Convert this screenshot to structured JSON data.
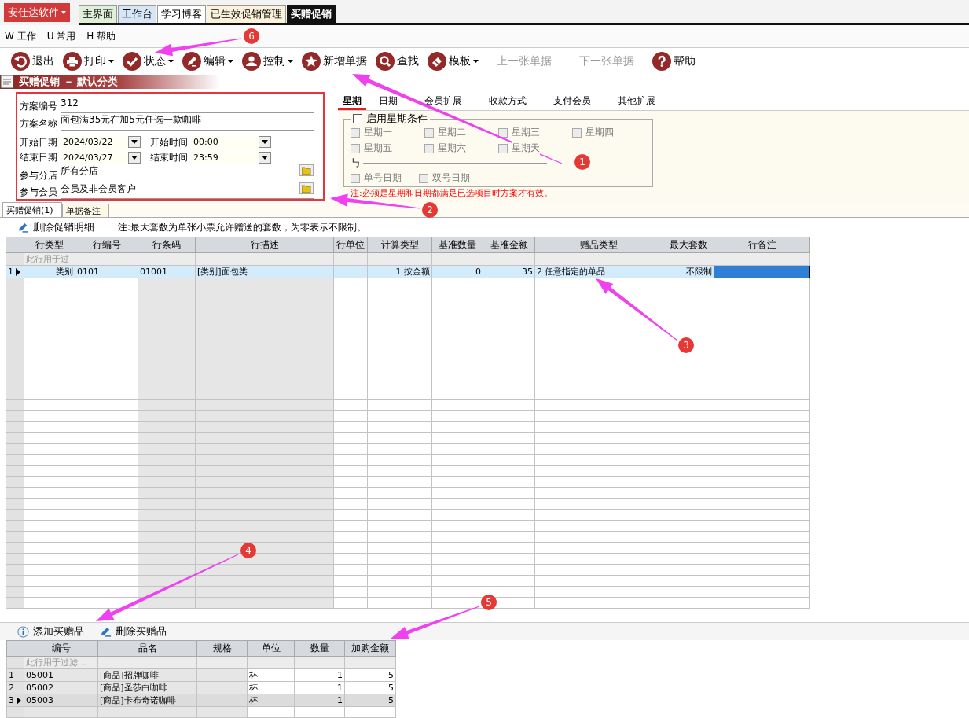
{
  "app_menu": {
    "label": "安仕达软件"
  },
  "doc_tabs": [
    {
      "label": "主界面",
      "color": "#dff0d8",
      "selected": false
    },
    {
      "label": "工作台",
      "color": "#d6e6f7",
      "selected": false
    },
    {
      "label": "学习博客",
      "color": "#ffffff",
      "selected": false
    },
    {
      "label": "已生效促销管理",
      "color": "#fbf2dc",
      "selected": false
    },
    {
      "label": "买赠促销",
      "color": "#111111",
      "selected": true
    }
  ],
  "menu": [
    "W 工作",
    "U 常用",
    "H 帮助"
  ],
  "toolbar": [
    {
      "label": "退出",
      "dropdown": false,
      "disabled": false
    },
    {
      "label": "打印",
      "dropdown": true,
      "disabled": false
    },
    {
      "label": "状态",
      "dropdown": true,
      "disabled": false
    },
    {
      "label": "编辑",
      "dropdown": true,
      "disabled": false
    },
    {
      "label": "控制",
      "dropdown": true,
      "disabled": false
    },
    {
      "label": "新增单据",
      "dropdown": false,
      "disabled": false
    },
    {
      "label": "查找",
      "dropdown": false,
      "disabled": false
    },
    {
      "label": "模板",
      "dropdown": true,
      "disabled": false
    },
    {
      "label": "上一张单据",
      "dropdown": false,
      "disabled": true
    },
    {
      "label": "下一张单据",
      "dropdown": false,
      "disabled": true
    },
    {
      "label": "帮助",
      "dropdown": false,
      "disabled": false
    }
  ],
  "document_title": "买赠促销 － 默认分类",
  "form": {
    "scheme_no": {
      "label": "方案编号",
      "value": "312"
    },
    "scheme_name": {
      "label": "方案名称",
      "value": "面包满35元在加5元任选一款咖啡"
    },
    "start_date": {
      "label": "开始日期",
      "value": "2024/03/22"
    },
    "start_time": {
      "label": "开始时间",
      "value": "00:00"
    },
    "end_date": {
      "label": "结束日期",
      "value": "2024/03/27"
    },
    "end_time": {
      "label": "结束时间",
      "value": "23:59"
    },
    "stores": {
      "label": "参与分店",
      "value": "所有分店"
    },
    "members": {
      "label": "参与会员",
      "value": "会员及非会员客户"
    }
  },
  "condition_tabs": [
    {
      "label": "星期",
      "selected": true
    },
    {
      "label": "日期",
      "selected": false
    },
    {
      "label": "会员扩展",
      "selected": false
    },
    {
      "label": "收款方式",
      "selected": false
    },
    {
      "label": "支付会员",
      "selected": false
    },
    {
      "label": "其他扩展",
      "selected": false
    }
  ],
  "weekday_panel": {
    "enable": {
      "label": "启用星期条件",
      "checked": false
    },
    "days": [
      {
        "label": "星期一",
        "checked": false,
        "disabled": true
      },
      {
        "label": "星期二",
        "checked": false,
        "disabled": true
      },
      {
        "label": "星期三",
        "checked": false,
        "disabled": true
      },
      {
        "label": "星期四",
        "checked": false,
        "disabled": true
      },
      {
        "label": "星期五",
        "checked": false,
        "disabled": true
      },
      {
        "label": "星期六",
        "checked": false,
        "disabled": true
      },
      {
        "label": "星期天",
        "checked": false,
        "disabled": true
      }
    ],
    "and_label": "与",
    "date_options": [
      {
        "label": "单号日期",
        "checked": false,
        "disabled": true
      },
      {
        "label": "双号日期",
        "checked": false,
        "disabled": true
      }
    ],
    "note": "注:必须是星期和日期都满足已选项目时方案才有效。"
  },
  "detail_tabs": [
    {
      "label": "买赠促销(1)",
      "selected": true
    },
    {
      "label": "单据备注",
      "selected": false
    }
  ],
  "detail_toolbar": {
    "delete_button": "删除促销明细",
    "note": "注:最大套数为单张小票允许赠送的套数，为零表示不限制。"
  },
  "detail_grid": {
    "columns": [
      {
        "label": "行类型",
        "kind": "number",
        "shaded": false
      },
      {
        "label": "行编号",
        "kind": "text",
        "shaded": false
      },
      {
        "label": "行条码",
        "kind": "text",
        "shaded": true
      },
      {
        "label": "行描述",
        "kind": "text",
        "shaded": true
      },
      {
        "label": "行单位",
        "kind": "text",
        "shaded": false
      },
      {
        "label": "计算类型",
        "kind": "number",
        "shaded": false
      },
      {
        "label": "基准数量",
        "kind": "number",
        "shaded": false
      },
      {
        "label": "基准金额",
        "kind": "number",
        "shaded": false
      },
      {
        "label": "赠品类型",
        "kind": "text",
        "shaded": false
      },
      {
        "label": "最大套数",
        "kind": "number",
        "shaded": false
      },
      {
        "label": "行备注",
        "kind": "text",
        "shaded": false
      }
    ],
    "filter_hint": "此行用于过",
    "rows": [
      {
        "number": "1",
        "selected": true,
        "cells": [
          "类别",
          "0101",
          "01001",
          "[类别]面包类",
          null,
          "1 按金额",
          "0",
          "35",
          "2 任意指定的单品",
          "不限制",
          {
            "focused": true
          }
        ]
      }
    ]
  },
  "gift_toolbar": [
    "添加买赠品",
    "删除买赠品"
  ],
  "gift_grid": {
    "columns": [
      {
        "label": "编号",
        "kind": "text",
        "shaded": true
      },
      {
        "label": "品名",
        "kind": "text",
        "shaded": true
      },
      {
        "label": "规格",
        "kind": "text",
        "shaded": true
      },
      {
        "label": "单位",
        "kind": "text",
        "shaded": false
      },
      {
        "label": "数量",
        "kind": "number",
        "shaded": false
      },
      {
        "label": "加购金额",
        "kind": "number",
        "shaded": false
      }
    ],
    "filter_hint": "此行用于过滤...",
    "rows": [
      {
        "number": "1",
        "selected": false,
        "cells": [
          "05001",
          "[商品]招牌咖啡",
          null,
          "杯",
          "1",
          "5"
        ]
      },
      {
        "number": "2",
        "selected": false,
        "cells": [
          "05002",
          "[商品]圣莎白咖啡",
          null,
          "杯",
          "1",
          "5"
        ]
      },
      {
        "number": "3",
        "selected": true,
        "cells": [
          "05003",
          "[商品]卡布奇诺咖啡",
          null,
          "杯",
          "1",
          "5"
        ]
      }
    ]
  },
  "annotations": [
    {
      "number": "1"
    },
    {
      "number": "2"
    },
    {
      "number": "3"
    },
    {
      "number": "4"
    },
    {
      "number": "5"
    },
    {
      "number": "6"
    }
  ]
}
